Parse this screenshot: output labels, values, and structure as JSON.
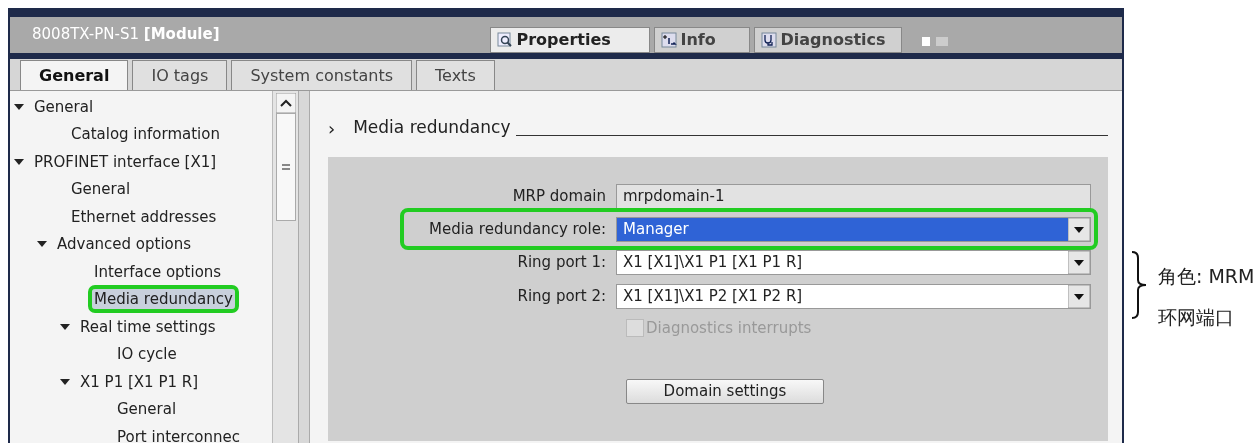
{
  "window": {
    "title": "8008TX-PN-S1",
    "title_suffix": "[Module]"
  },
  "inspector_tabs": [
    {
      "label": "Properties",
      "kind": "properties",
      "selected": true
    },
    {
      "label": "Info",
      "kind": "info",
      "selected": false
    },
    {
      "label": "Diagnostics",
      "kind": "diagnostics",
      "selected": false
    }
  ],
  "tabs": [
    {
      "label": "General",
      "selected": true
    },
    {
      "label": "IO tags",
      "selected": false
    },
    {
      "label": "System constants",
      "selected": false
    },
    {
      "label": "Texts",
      "selected": false
    }
  ],
  "sidebar": {
    "items": [
      {
        "label": "General",
        "expanded": true,
        "selected": false,
        "highlighted": false,
        "children": [
          {
            "label": "Catalog information",
            "selected": false,
            "highlighted": false
          }
        ]
      },
      {
        "label": "PROFINET interface [X1]",
        "expanded": true,
        "selected": false,
        "highlighted": false,
        "children": [
          {
            "label": "General",
            "selected": false,
            "highlighted": false
          },
          {
            "label": "Ethernet addresses",
            "selected": false,
            "highlighted": false
          },
          {
            "label": "Advanced options",
            "expanded": true,
            "selected": false,
            "highlighted": false,
            "children": [
              {
                "label": "Interface options",
                "selected": false,
                "highlighted": false
              },
              {
                "label": "Media redundancy",
                "selected": true,
                "highlighted": true
              },
              {
                "label": "Real time settings",
                "expanded": true,
                "selected": false,
                "highlighted": false,
                "children": [
                  {
                    "label": "IO cycle",
                    "selected": false,
                    "highlighted": false
                  }
                ]
              },
              {
                "label": "X1 P1 [X1 P1 R]",
                "expanded": true,
                "selected": false,
                "highlighted": false,
                "children": [
                  {
                    "label": "General",
                    "selected": false,
                    "highlighted": false
                  },
                  {
                    "label": "Port interconnec",
                    "selected": false,
                    "highlighted": false
                  }
                ]
              }
            ]
          }
        ]
      }
    ]
  },
  "section": {
    "marker": "›",
    "title": "Media redundancy"
  },
  "fields": [
    {
      "kind": "text",
      "label": "MRP domain",
      "value": "mrpdomain-1",
      "highlighted": false
    },
    {
      "kind": "select",
      "label": "Media redundancy role:",
      "value": "Manager",
      "highlighted": true
    },
    {
      "kind": "select",
      "label": "Ring port 1:",
      "value": "X1 [X1]\\X1 P1 [X1 P1 R]",
      "highlighted": false
    },
    {
      "kind": "select",
      "label": "Ring port 2:",
      "value": "X1 [X1]\\X1 P2 [X1 P2 R]",
      "highlighted": false
    }
  ],
  "checkbox": {
    "label": "Diagnostics interrupts",
    "checked": false,
    "disabled": true
  },
  "domain_button": "Domain settings",
  "annotations": [
    "角色: MRM",
    "环网端口"
  ]
}
